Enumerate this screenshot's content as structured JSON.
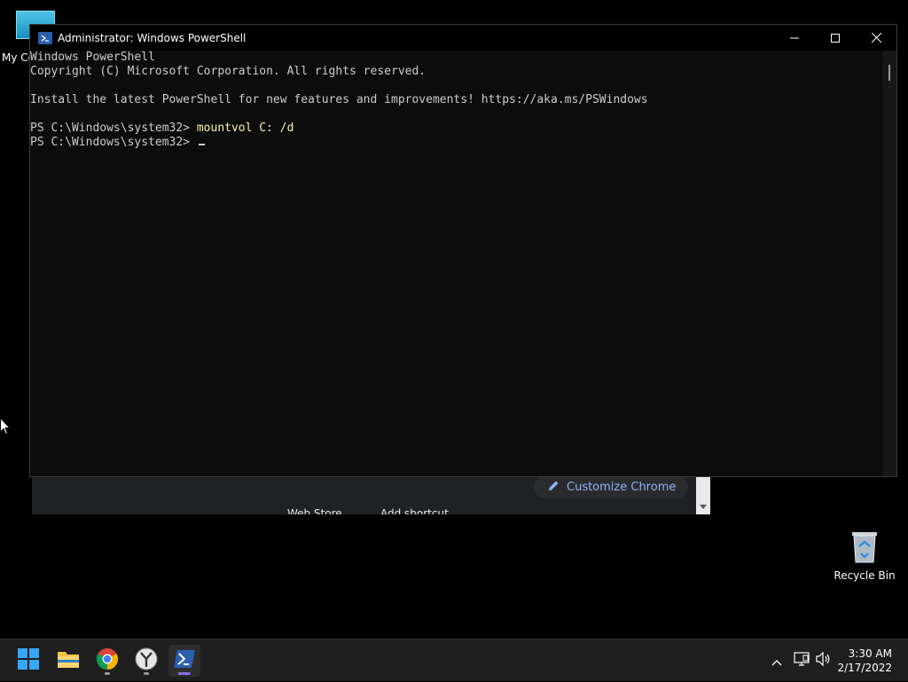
{
  "desktop": {
    "this_pc_label": "My Co",
    "recycle_bin_label": "Recycle Bin"
  },
  "chrome_bg": {
    "web_store_label": "Web Store",
    "add_shortcut_label": "Add shortcut",
    "customize_label": "Customize Chrome"
  },
  "powershell": {
    "title": "Administrator: Windows PowerShell",
    "lines": {
      "l1": "Windows PowerShell",
      "l2": "Copyright (C) Microsoft Corporation. All rights reserved.",
      "l3": "",
      "l4": "Install the latest PowerShell for new features and improvements! https://aka.ms/PSWindows",
      "l5": "",
      "l6_prompt": "PS C:\\Windows\\system32> ",
      "l6_cmd": "mountvol C: /d",
      "l7_prompt": "PS C:\\Windows\\system32> "
    }
  },
  "taskbar": {
    "apps": [
      "start-icon",
      "file-explorer-icon",
      "chrome-icon",
      "clock-app-icon",
      "powershell-icon"
    ],
    "time": "3:30 AM",
    "date": "2/17/2022"
  },
  "colors": {
    "console_bg": "#0c0c0c",
    "console_text": "#cccccc",
    "command_text": "#f9f1a5",
    "taskbar_bg": "#1f1f1f"
  }
}
